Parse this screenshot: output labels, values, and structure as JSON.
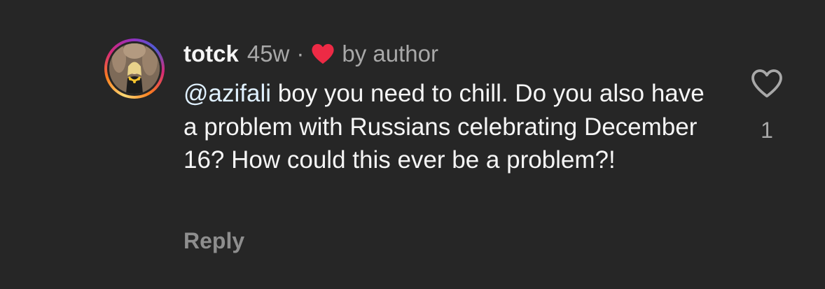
{
  "comment": {
    "username": "totck",
    "time": "45w",
    "separator": "·",
    "liked_by_author_label": "by author",
    "mention": "@azifali",
    "text": " boy you need to chill. Do you also have a problem with Russians celebrating December 16? How could this ever be a problem?!",
    "reply_label": "Reply",
    "like_count": "1"
  },
  "icons": {
    "author_heart": "heart-filled-icon",
    "like": "heart-outline-icon"
  },
  "colors": {
    "background": "#262626",
    "author_heart": "#ed2a45",
    "secondary_text": "#a8a8a8",
    "mention": "#e0f1ff"
  }
}
